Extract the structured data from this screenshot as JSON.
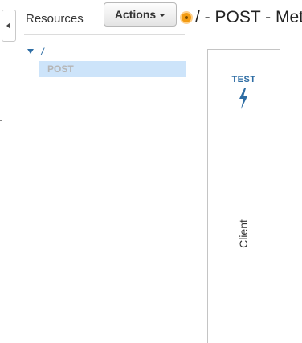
{
  "resources_panel": {
    "title": "Resources",
    "actions_label": "Actions",
    "tree": {
      "root_path": "/",
      "items": [
        {
          "method": "POST",
          "selected": true
        }
      ]
    }
  },
  "main": {
    "page_title": "/ - POST - Met",
    "client_card": {
      "test_label": "TEST",
      "icon": "lightning-bolt-icon",
      "label": "Client"
    }
  },
  "colors": {
    "link_blue": "#2e6da4",
    "selection": "#cde4fa",
    "status_orange": "#f39c12"
  }
}
